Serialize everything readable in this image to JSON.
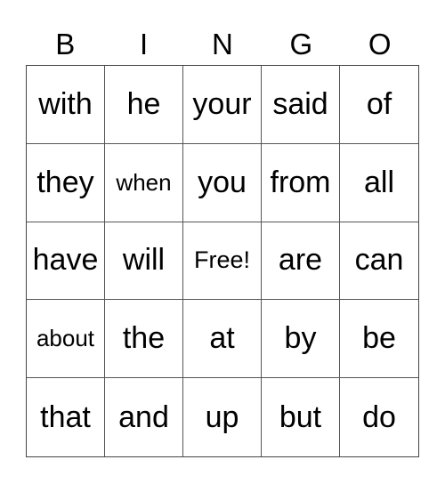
{
  "header": [
    "B",
    "I",
    "N",
    "G",
    "O"
  ],
  "rows": [
    [
      "with",
      "he",
      "your",
      "said",
      "of"
    ],
    [
      "they",
      "when",
      "you",
      "from",
      "all"
    ],
    [
      "have",
      "will",
      "Free!",
      "are",
      "can"
    ],
    [
      "about",
      "the",
      "at",
      "by",
      "be"
    ],
    [
      "that",
      "and",
      "up",
      "but",
      "do"
    ]
  ]
}
